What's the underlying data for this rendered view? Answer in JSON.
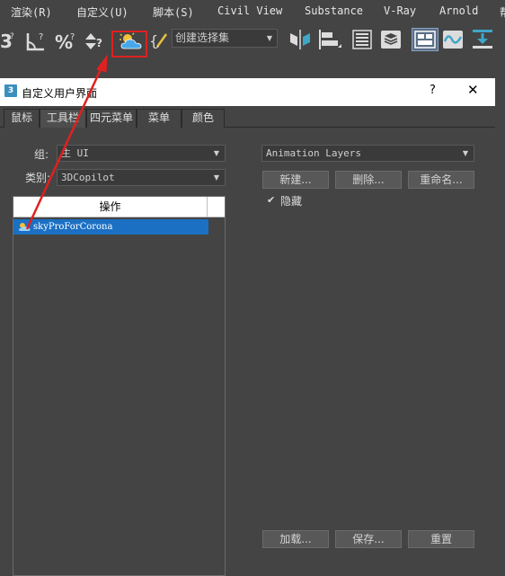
{
  "menubar": {
    "items": [
      "渲染(R)",
      "自定义(U)",
      "脚本(S)",
      "Civil View",
      "Substance",
      "V-Ray",
      "Arnold",
      "帮"
    ]
  },
  "toolbar": {
    "named_selection_placeholder": "创建选择集",
    "icons": [
      "snap-3d-icon",
      "angle-snap-icon",
      "percent-snap-icon",
      "spinner-snap-icon",
      "sky-corona-icon",
      "edit-named-selection-icon",
      "mirror-icon",
      "align-icon",
      "layer-explorer-icon",
      "scene-explorer-icon",
      "ribbon-icon",
      "curve-editor-icon",
      "render-setup-icon"
    ]
  },
  "dialog": {
    "icon_text": "3",
    "title": "自定义用户界面",
    "help": "?",
    "close": "✕",
    "tabs": [
      "鼠标",
      "工具栏",
      "四元菜单",
      "菜单",
      "颜色"
    ],
    "active_tab": "工具栏",
    "group_label": "组:",
    "group_value": "主 UI",
    "category_label": "类别:",
    "category_value": "3DCopilot",
    "list_header": "操作",
    "list_items": [
      "skyProForCorona"
    ],
    "toolbar_dropdown_value": "Animation Layers",
    "buttons": {
      "new": "新建...",
      "delete": "删除...",
      "rename": "重命名...",
      "load": "加载...",
      "save": "保存...",
      "reset": "重置"
    },
    "hide_label": "隐藏",
    "hide_checked": true
  },
  "colors": {
    "background": "#444444",
    "selection": "#1b70c4",
    "annotation": "#e02020"
  }
}
